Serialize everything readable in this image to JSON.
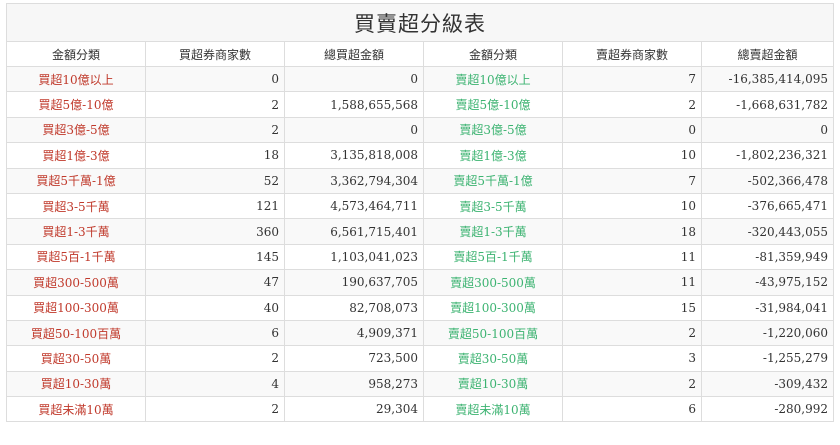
{
  "title": "買賣超分級表",
  "colors": {
    "buy": "#c0392b",
    "sell": "#3cb371"
  },
  "headers": [
    "金額分類",
    "買超券商家數",
    "總買超金額",
    "金額分類",
    "賣超券商家數",
    "總賣超金額"
  ],
  "rows": [
    {
      "buy_cat": "買超10億以上",
      "buy_count": "0",
      "buy_total": "0",
      "sell_cat": "賣超10億以上",
      "sell_count": "7",
      "sell_total": "-16,385,414,095"
    },
    {
      "buy_cat": "買超5億-10億",
      "buy_count": "2",
      "buy_total": "1,588,655,568",
      "sell_cat": "賣超5億-10億",
      "sell_count": "2",
      "sell_total": "-1,668,631,782"
    },
    {
      "buy_cat": "買超3億-5億",
      "buy_count": "2",
      "buy_total": "0",
      "sell_cat": "賣超3億-5億",
      "sell_count": "0",
      "sell_total": "0"
    },
    {
      "buy_cat": "買超1億-3億",
      "buy_count": "18",
      "buy_total": "3,135,818,008",
      "sell_cat": "賣超1億-3億",
      "sell_count": "10",
      "sell_total": "-1,802,236,321"
    },
    {
      "buy_cat": "買超5千萬-1億",
      "buy_count": "52",
      "buy_total": "3,362,794,304",
      "sell_cat": "賣超5千萬-1億",
      "sell_count": "7",
      "sell_total": "-502,366,478"
    },
    {
      "buy_cat": "買超3-5千萬",
      "buy_count": "121",
      "buy_total": "4,573,464,711",
      "sell_cat": "賣超3-5千萬",
      "sell_count": "10",
      "sell_total": "-376,665,471"
    },
    {
      "buy_cat": "買超1-3千萬",
      "buy_count": "360",
      "buy_total": "6,561,715,401",
      "sell_cat": "賣超1-3千萬",
      "sell_count": "18",
      "sell_total": "-320,443,055"
    },
    {
      "buy_cat": "買超5百-1千萬",
      "buy_count": "145",
      "buy_total": "1,103,041,023",
      "sell_cat": "賣超5百-1千萬",
      "sell_count": "11",
      "sell_total": "-81,359,949"
    },
    {
      "buy_cat": "買超300-500萬",
      "buy_count": "47",
      "buy_total": "190,637,705",
      "sell_cat": "賣超300-500萬",
      "sell_count": "11",
      "sell_total": "-43,975,152"
    },
    {
      "buy_cat": "買超100-300萬",
      "buy_count": "40",
      "buy_total": "82,708,073",
      "sell_cat": "賣超100-300萬",
      "sell_count": "15",
      "sell_total": "-31,984,041"
    },
    {
      "buy_cat": "買超50-100百萬",
      "buy_count": "6",
      "buy_total": "4,909,371",
      "sell_cat": "賣超50-100百萬",
      "sell_count": "2",
      "sell_total": "-1,220,060"
    },
    {
      "buy_cat": "買超30-50萬",
      "buy_count": "2",
      "buy_total": "723,500",
      "sell_cat": "賣超30-50萬",
      "sell_count": "3",
      "sell_total": "-1,255,279"
    },
    {
      "buy_cat": "買超10-30萬",
      "buy_count": "4",
      "buy_total": "958,273",
      "sell_cat": "賣超10-30萬",
      "sell_count": "2",
      "sell_total": "-309,432"
    },
    {
      "buy_cat": "買超未滿10萬",
      "buy_count": "2",
      "buy_total": "29,304",
      "sell_cat": "賣超未滿10萬",
      "sell_count": "6",
      "sell_total": "-280,992"
    }
  ]
}
